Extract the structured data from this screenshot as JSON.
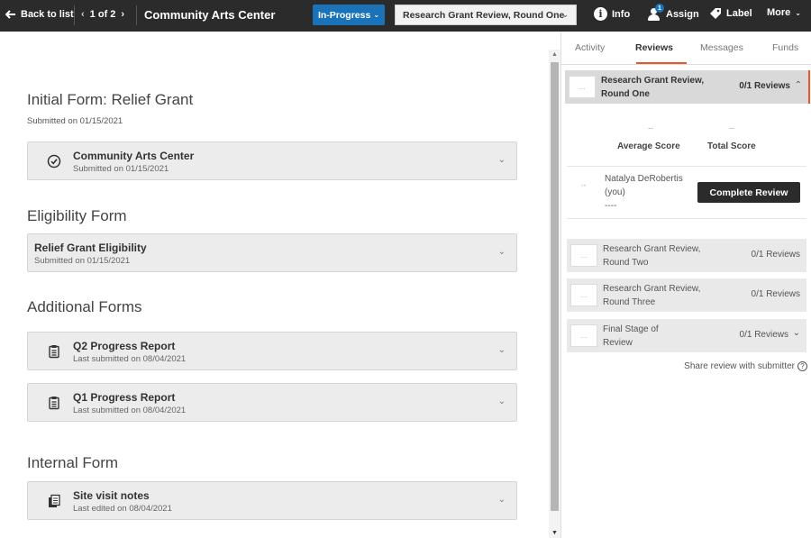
{
  "topbar": {
    "back_label": "Back to list",
    "pager_label": "1 of 2",
    "org_title": "Community Arts Center",
    "status_label": "In-Progress",
    "stage_select_value": "Research Grant Review, Round One",
    "info_label": "Info",
    "assign_label": "Assign",
    "assign_badge": "1",
    "label_label": "Label",
    "more_label": "More"
  },
  "main": {
    "initial_form": {
      "heading": "Initial Form: Relief Grant",
      "submitted": "Submitted on 01/15/2021",
      "card": {
        "title": "Community Arts Center",
        "meta": "Submitted on 01/15/2021"
      }
    },
    "eligibility": {
      "heading": "Eligibility Form",
      "card": {
        "title": "Relief Grant Eligibility",
        "meta": "Submitted on 01/15/2021"
      }
    },
    "additional": {
      "heading": "Additional Forms",
      "cards": [
        {
          "title": "Q2 Progress Report",
          "meta": "Last submitted on 08/04/2021"
        },
        {
          "title": "Q1 Progress Report",
          "meta": "Last submitted on 08/04/2021"
        }
      ]
    },
    "internal": {
      "heading": "Internal Form",
      "card": {
        "title": "Site visit notes",
        "meta": "Last edited on 08/04/2021"
      }
    }
  },
  "panel": {
    "tabs": [
      "Activity",
      "Reviews",
      "Messages",
      "Funds"
    ],
    "active_tab": "Reviews",
    "stages": [
      {
        "name": "Research Grant Review, Round One",
        "count": "0/1 Reviews",
        "thumb": "..."
      },
      {
        "name": "Research Grant Review, Round Two",
        "count": "0/1 Reviews",
        "thumb": "..."
      },
      {
        "name": "Research Grant Review, Round Three",
        "count": "0/1 Reviews",
        "thumb": "..."
      },
      {
        "name": "Final Stage of Review",
        "count": "0/1 Reviews",
        "thumb": "..."
      }
    ],
    "scores": {
      "average_label": "Average Score",
      "average_value": "--",
      "total_label": "Total Score",
      "total_value": "--"
    },
    "reviewer": {
      "thumb": "--",
      "name": "Natalya DeRobertis",
      "you": "(you)",
      "score": "----",
      "button_label": "Complete Review"
    },
    "share_label": "Share review with submitter"
  },
  "colors": {
    "topbar": "#2b2b2b",
    "status_blue": "#1a73b8",
    "accent_orange": "#e8562a"
  }
}
